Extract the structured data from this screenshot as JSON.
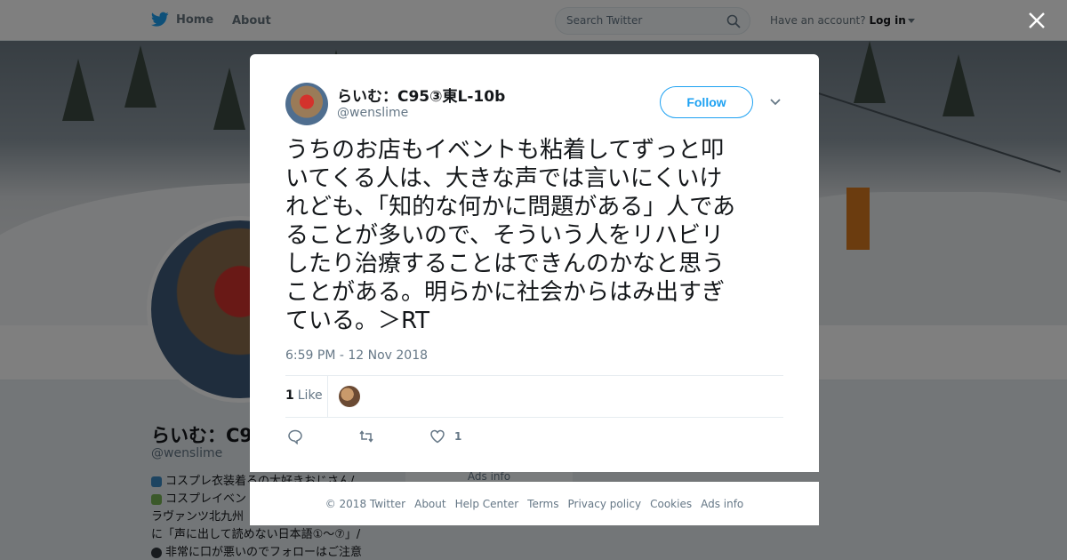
{
  "topbar": {
    "home_label": "Home",
    "about_label": "About",
    "search_placeholder": "Search Twitter",
    "account_prompt": "Have an account?",
    "login_label": "Log in"
  },
  "profile": {
    "name": "らいむ：C9",
    "handle": "@wenslime",
    "bio_lines": [
      "コスプレ衣装着るの大好きおじさん/",
      "コスプレイベン",
      "ラヴァンツ北九州",
      "に「声に出して読めない日本語①～⑦」/",
      "非常に口が悪いのでフォローはご注意"
    ],
    "bio_icon_colors": [
      "#3b88c3",
      "#77b255",
      "",
      "",
      "#31373d"
    ],
    "ads_info": "Ads info"
  },
  "tweet": {
    "author_name": "らいむ：C95③東L-10b",
    "author_handle": "@wenslime",
    "follow_label": "Follow",
    "text": "うちのお店もイベントも粘着してずっと叩\nいてくる人は、大きな声では言いにくいけ\nれども、「知的な何かに問題がある」人であ\nることが多いので、そういう人をリハビリ\nしたり治療することはできんのかなと思う\nことがある。明らかに社会からはみ出すぎ\nている。＞RT",
    "timestamp": "6:59 PM - 12 Nov 2018",
    "like_count": "1",
    "like_label": "Like",
    "action_like_count": "1"
  },
  "footer": {
    "links": [
      "© 2018 Twitter",
      "About",
      "Help Center",
      "Terms",
      "Privacy policy",
      "Cookies",
      "Ads info"
    ]
  },
  "colors": {
    "accent": "#1da1f2",
    "secondary_text": "#657786",
    "overlay": "rgba(0,0,0,0.5)"
  }
}
